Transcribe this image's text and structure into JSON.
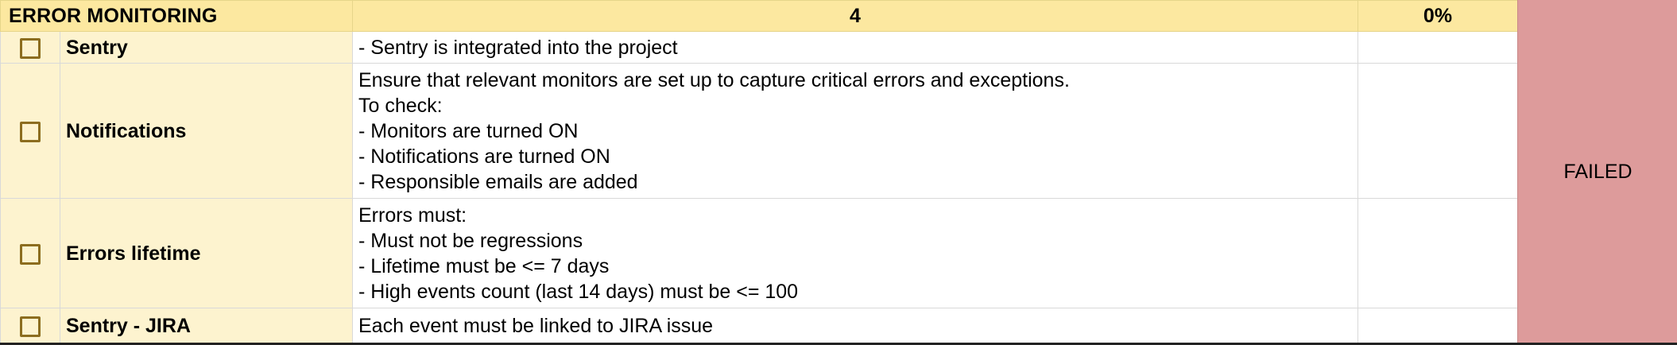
{
  "section": {
    "title": "ERROR MONITORING",
    "count": "4",
    "percent": "0%"
  },
  "rows": [
    {
      "name": "Sentry",
      "checked": false,
      "lines": [
        "- Sentry is integrated into the project"
      ]
    },
    {
      "name": "Notifications",
      "checked": false,
      "lines": [
        "Ensure that relevant monitors are set up to capture critical errors and exceptions.",
        "To check:",
        "- Monitors are turned ON",
        "- Notifications are turned ON",
        "- Responsible emails are added"
      ]
    },
    {
      "name": "Errors lifetime",
      "checked": false,
      "lines": [
        "Errors must:",
        "- Must not be regressions",
        "- Lifetime must be <= 7 days",
        "- High events count (last 14 days) must be <= 100"
      ]
    },
    {
      "name": "Sentry - JIRA",
      "checked": false,
      "lines": [
        "Each event must be linked to JIRA issue"
      ]
    }
  ],
  "status": {
    "label": "FAILED",
    "color": "#dd9b9b"
  },
  "colors": {
    "header_bg": "#fce8a0",
    "name_bg": "#fdf3cf",
    "checkbox_border": "#8c6d1f"
  }
}
